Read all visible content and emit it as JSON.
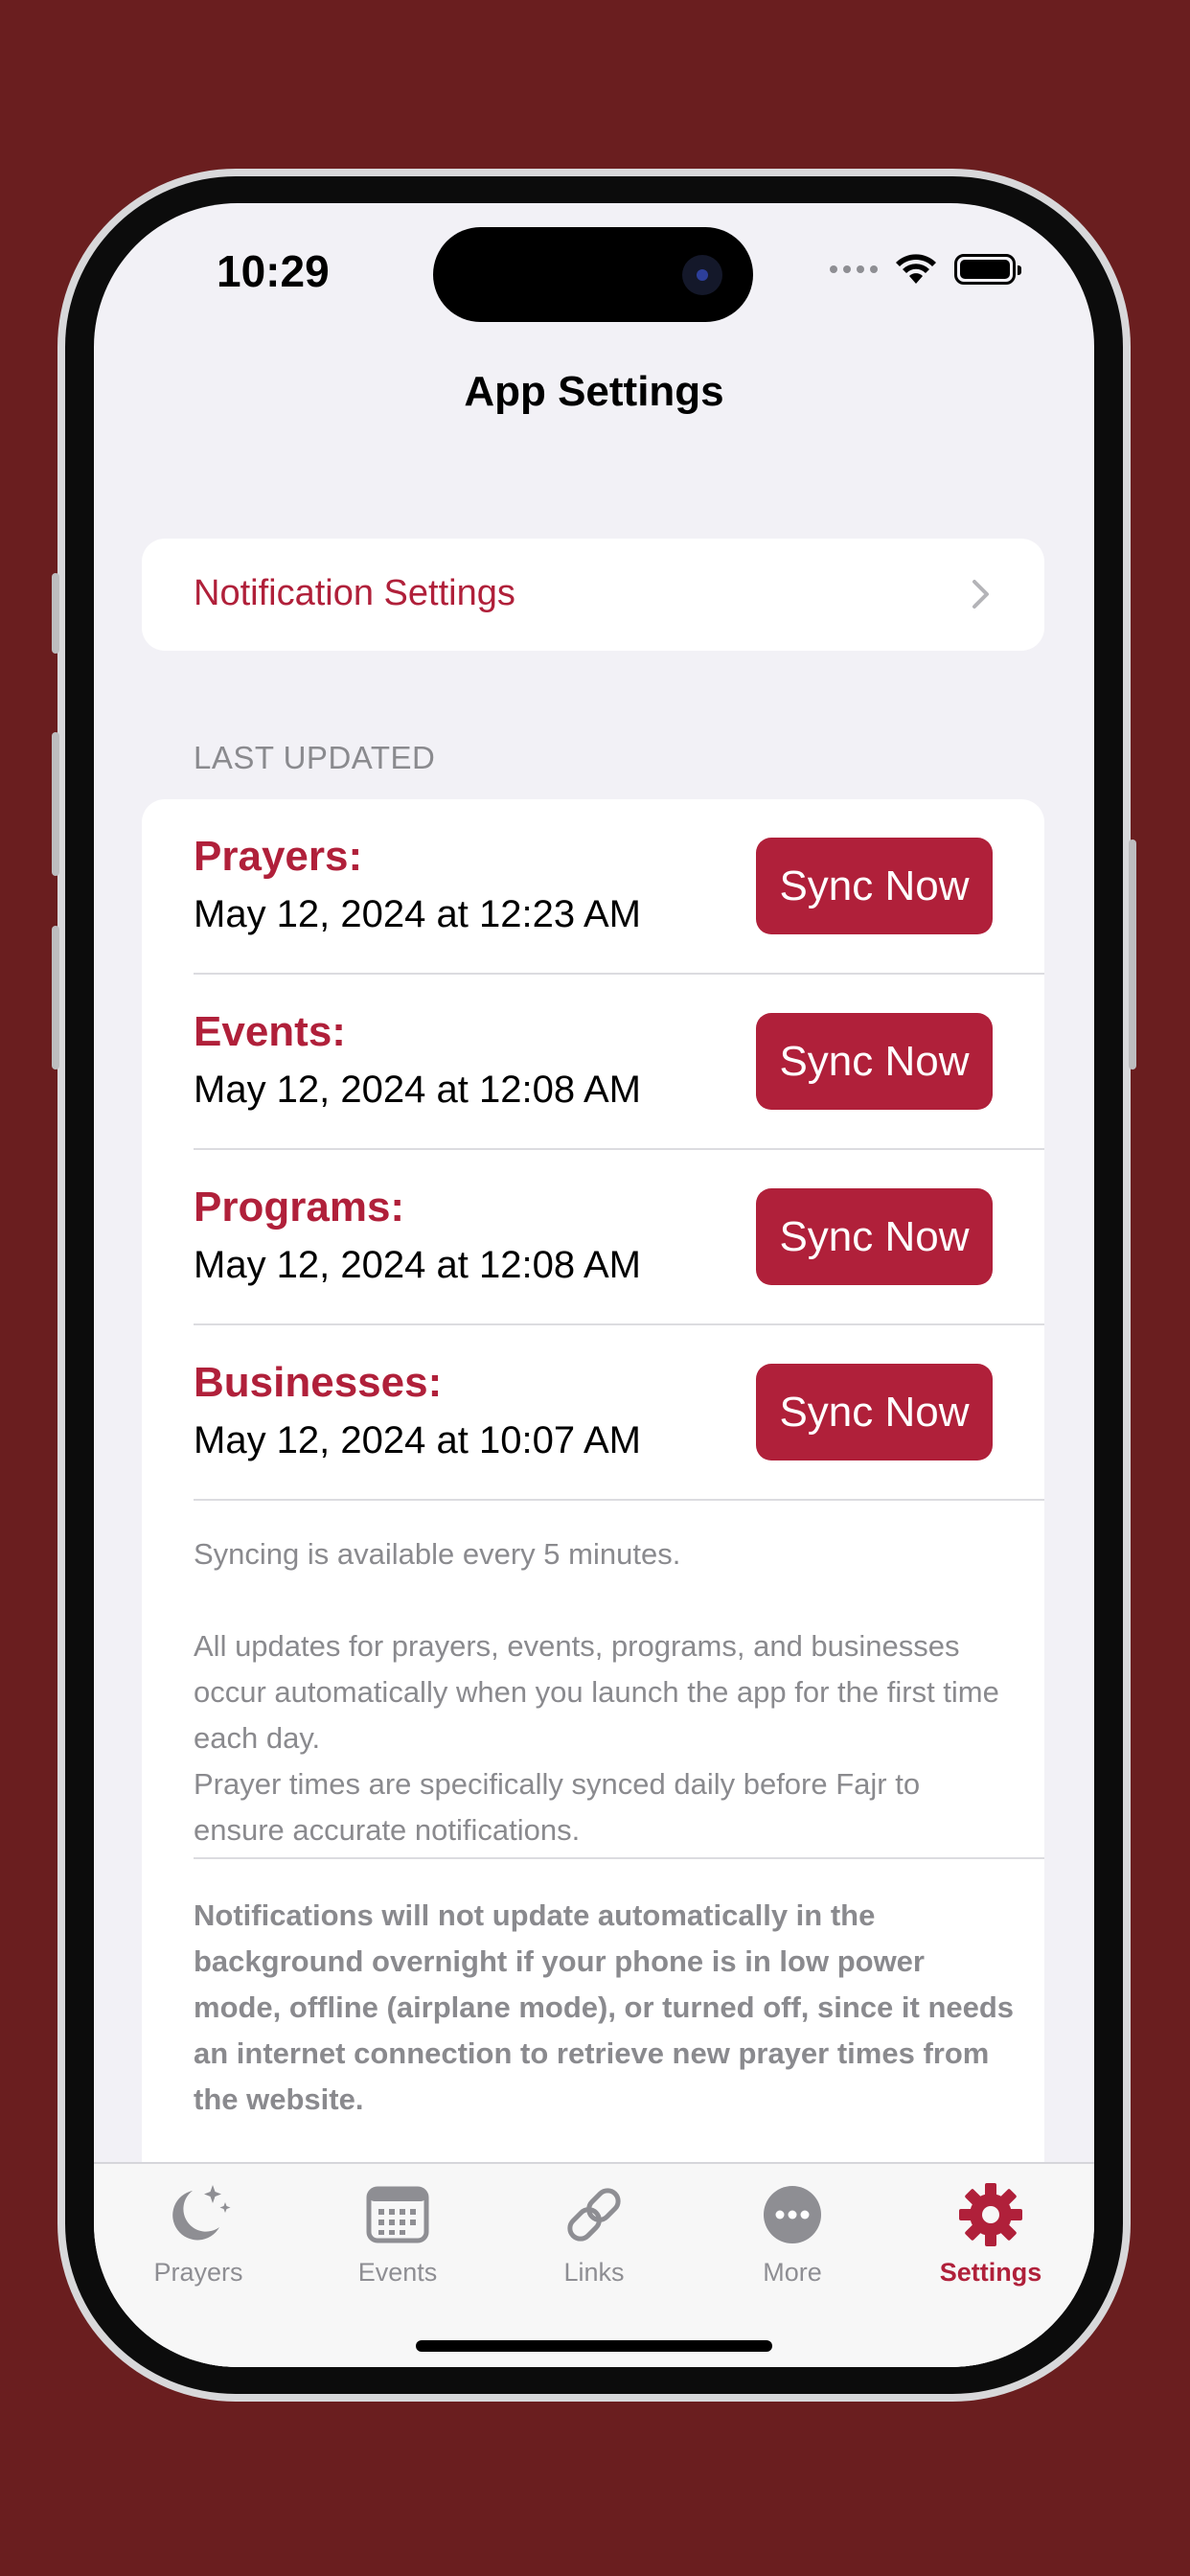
{
  "status_bar": {
    "time": "10:29"
  },
  "nav": {
    "title": "App Settings"
  },
  "notification_settings": {
    "label": "Notification Settings"
  },
  "last_updated": {
    "header": "LAST UPDATED",
    "rows": [
      {
        "title": "Prayers:",
        "date": "May 12, 2024 at 12:23 AM",
        "button": "Sync Now"
      },
      {
        "title": "Events:",
        "date": "May 12, 2024 at 12:08 AM",
        "button": "Sync Now"
      },
      {
        "title": "Programs:",
        "date": "May 12, 2024 at 12:08 AM",
        "button": "Sync Now"
      },
      {
        "title": "Businesses:",
        "date": "May 12, 2024 at 10:07 AM",
        "button": "Sync Now"
      }
    ],
    "note_interval": "Syncing is available every 5 minutes.",
    "note_auto": "All updates for prayers, events, programs, and businesses occur automatically when you launch the app for the first time each day.",
    "note_prayer": "Prayer times are specifically synced daily before Fajr to ensure accurate notifications.",
    "note_warning": "Notifications will not update automatically in the background overnight if your phone is in low power mode, offline (airplane mode), or turned off, since it needs an internet connection to retrieve new prayer times from the website."
  },
  "tabs": [
    {
      "label": "Prayers",
      "icon": "moon-stars-icon"
    },
    {
      "label": "Events",
      "icon": "calendar-icon"
    },
    {
      "label": "Links",
      "icon": "link-icon"
    },
    {
      "label": "More",
      "icon": "ellipsis-circle-icon"
    },
    {
      "label": "Settings",
      "icon": "gear-icon",
      "active": true
    }
  ],
  "colors": {
    "accent": "#b0203a",
    "background": "#6a1e1f",
    "screen_bg": "#f2f1f6"
  }
}
